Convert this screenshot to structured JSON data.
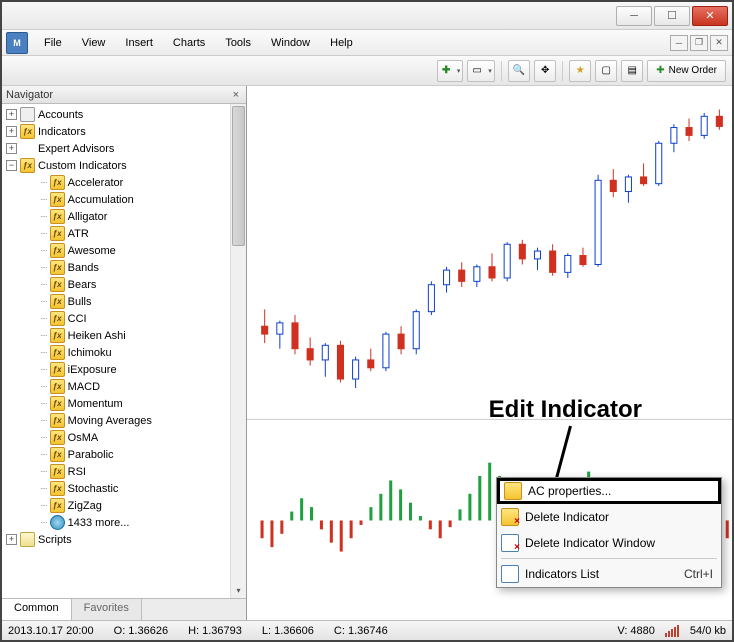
{
  "menu": {
    "file": "File",
    "view": "View",
    "insert": "Insert",
    "charts": "Charts",
    "tools": "Tools",
    "window": "Window",
    "help": "Help"
  },
  "toolbar": {
    "new_order": "New Order"
  },
  "navigator": {
    "title": "Navigator",
    "accounts": "Accounts",
    "indicators": "Indicators",
    "expert_advisors": "Expert Advisors",
    "custom_indicators": "Custom Indicators",
    "scripts": "Scripts",
    "more": "1433 more...",
    "items": [
      "Accelerator",
      "Accumulation",
      "Alligator",
      "ATR",
      "Awesome",
      "Bands",
      "Bears",
      "Bulls",
      "CCI",
      "Heiken Ashi",
      "Ichimoku",
      "iExposure",
      "MACD",
      "Momentum",
      "Moving Averages",
      "OsMA",
      "Parabolic",
      "RSI",
      "Stochastic",
      "ZigZag"
    ],
    "tabs": {
      "common": "Common",
      "favorites": "Favorites"
    }
  },
  "context_menu": {
    "properties": "AC properties...",
    "delete_indicator": "Delete Indicator",
    "delete_window": "Delete Indicator Window",
    "indicators_list": "Indicators List",
    "shortcut": "Ctrl+I"
  },
  "annotation": {
    "label": "Edit Indicator"
  },
  "statusbar": {
    "datetime": "2013.10.17 20:00",
    "open": "O: 1.36626",
    "high": "H: 1.36793",
    "low": "L: 1.36606",
    "close": "C: 1.36746",
    "volume": "V: 4880",
    "bytes": "54/0 kb"
  },
  "chart_data": {
    "type": "candlestick",
    "title": "",
    "xlabel": "",
    "ylabel": "",
    "series": [
      {
        "o": 1.3625,
        "h": 1.364,
        "l": 1.361,
        "c": 1.3618,
        "dir": "down"
      },
      {
        "o": 1.3618,
        "h": 1.363,
        "l": 1.3605,
        "c": 1.3628,
        "dir": "up"
      },
      {
        "o": 1.3628,
        "h": 1.3635,
        "l": 1.36,
        "c": 1.3605,
        "dir": "down"
      },
      {
        "o": 1.3605,
        "h": 1.3615,
        "l": 1.359,
        "c": 1.3595,
        "dir": "down"
      },
      {
        "o": 1.3595,
        "h": 1.361,
        "l": 1.358,
        "c": 1.3608,
        "dir": "up"
      },
      {
        "o": 1.3608,
        "h": 1.3612,
        "l": 1.3575,
        "c": 1.3578,
        "dir": "down"
      },
      {
        "o": 1.3578,
        "h": 1.3598,
        "l": 1.357,
        "c": 1.3595,
        "dir": "up"
      },
      {
        "o": 1.3595,
        "h": 1.3605,
        "l": 1.3585,
        "c": 1.3588,
        "dir": "down"
      },
      {
        "o": 1.3588,
        "h": 1.362,
        "l": 1.3585,
        "c": 1.3618,
        "dir": "up"
      },
      {
        "o": 1.3618,
        "h": 1.3625,
        "l": 1.36,
        "c": 1.3605,
        "dir": "down"
      },
      {
        "o": 1.3605,
        "h": 1.364,
        "l": 1.36,
        "c": 1.3638,
        "dir": "up"
      },
      {
        "o": 1.3638,
        "h": 1.3665,
        "l": 1.3635,
        "c": 1.3662,
        "dir": "up"
      },
      {
        "o": 1.3662,
        "h": 1.3678,
        "l": 1.3655,
        "c": 1.3675,
        "dir": "up"
      },
      {
        "o": 1.3675,
        "h": 1.3682,
        "l": 1.366,
        "c": 1.3665,
        "dir": "down"
      },
      {
        "o": 1.3665,
        "h": 1.368,
        "l": 1.366,
        "c": 1.3678,
        "dir": "up"
      },
      {
        "o": 1.3678,
        "h": 1.369,
        "l": 1.3665,
        "c": 1.3668,
        "dir": "down"
      },
      {
        "o": 1.3668,
        "h": 1.37,
        "l": 1.3665,
        "c": 1.3698,
        "dir": "up"
      },
      {
        "o": 1.3698,
        "h": 1.3702,
        "l": 1.368,
        "c": 1.3685,
        "dir": "down"
      },
      {
        "o": 1.3685,
        "h": 1.3695,
        "l": 1.3675,
        "c": 1.3692,
        "dir": "up"
      },
      {
        "o": 1.3692,
        "h": 1.3698,
        "l": 1.367,
        "c": 1.3673,
        "dir": "down"
      },
      {
        "o": 1.3673,
        "h": 1.369,
        "l": 1.3668,
        "c": 1.3688,
        "dir": "up"
      },
      {
        "o": 1.3688,
        "h": 1.3695,
        "l": 1.3678,
        "c": 1.368,
        "dir": "down"
      },
      {
        "o": 1.368,
        "h": 1.376,
        "l": 1.3678,
        "c": 1.3755,
        "dir": "up"
      },
      {
        "o": 1.3755,
        "h": 1.3765,
        "l": 1.374,
        "c": 1.3745,
        "dir": "down"
      },
      {
        "o": 1.3745,
        "h": 1.376,
        "l": 1.3735,
        "c": 1.3758,
        "dir": "up"
      },
      {
        "o": 1.3758,
        "h": 1.377,
        "l": 1.375,
        "c": 1.3752,
        "dir": "down"
      },
      {
        "o": 1.3752,
        "h": 1.379,
        "l": 1.375,
        "c": 1.3788,
        "dir": "up"
      },
      {
        "o": 1.3788,
        "h": 1.3805,
        "l": 1.378,
        "c": 1.3802,
        "dir": "up"
      },
      {
        "o": 1.3802,
        "h": 1.381,
        "l": 1.379,
        "c": 1.3795,
        "dir": "down"
      },
      {
        "o": 1.3795,
        "h": 1.3815,
        "l": 1.3792,
        "c": 1.3812,
        "dir": "up"
      },
      {
        "o": 1.3812,
        "h": 1.3818,
        "l": 1.38,
        "c": 1.3803,
        "dir": "down"
      }
    ],
    "indicator": {
      "type": "histogram",
      "name": "Accelerator",
      "values": [
        -8,
        -12,
        -6,
        4,
        10,
        6,
        -4,
        -10,
        -14,
        -8,
        -2,
        6,
        12,
        18,
        14,
        8,
        2,
        -4,
        -8,
        -3,
        5,
        12,
        20,
        26,
        20,
        14,
        8,
        2,
        -4,
        -8,
        4,
        10,
        16,
        22,
        18,
        12,
        6,
        -2,
        -8,
        -12,
        -6,
        2,
        8,
        14,
        10,
        4,
        -2,
        -8
      ]
    }
  }
}
